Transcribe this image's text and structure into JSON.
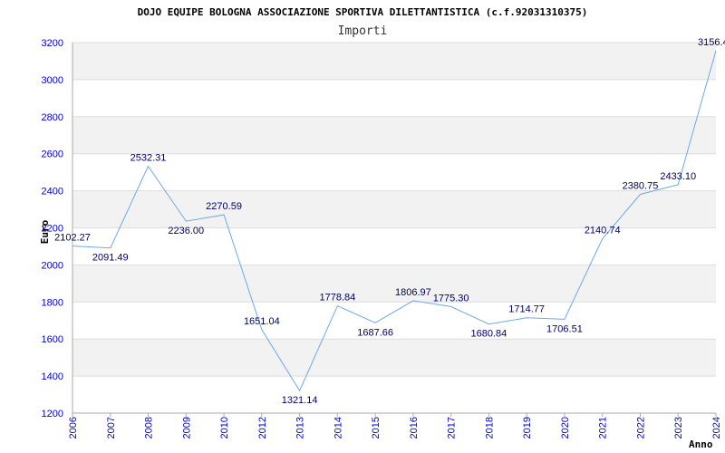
{
  "chart_data": {
    "type": "line",
    "title": "DOJO EQUIPE BOLOGNA ASSOCIAZIONE SPORTIVA DILETTANTISTICA (c.f.92031310375)",
    "subtitle": "Importi",
    "xlabel": "Anno",
    "ylabel": "Euro",
    "ylim": [
      1200,
      3200
    ],
    "yticks": [
      1200,
      1400,
      1600,
      1800,
      2000,
      2200,
      2400,
      2600,
      2800,
      3000,
      3200
    ],
    "x": [
      "2006",
      "2007",
      "2008",
      "2009",
      "2010",
      "2012",
      "2013",
      "2014",
      "2015",
      "2016",
      "2017",
      "2018",
      "2019",
      "2020",
      "2021",
      "2022",
      "2023",
      "2024"
    ],
    "values": [
      2102.27,
      2091.49,
      2532.31,
      2236.0,
      2270.59,
      1651.04,
      1321.14,
      1778.84,
      1687.66,
      1806.97,
      1775.3,
      1680.84,
      1714.77,
      1706.51,
      2140.74,
      2380.75,
      2433.1,
      3156.4
    ],
    "labels": [
      "2102.27",
      "2091.49",
      "2532.31",
      "2236.00",
      "2270.59",
      "1651.04",
      "1321.14",
      "1778.84",
      "1687.66",
      "1806.97",
      "1775.30",
      "1680.84",
      "1714.77",
      "1706.51",
      "2140.74",
      "2380.75",
      "2433.10",
      "3156.4"
    ],
    "grid": true,
    "line_color": "#6fa8e8",
    "tick_color": "#0000cc",
    "label_color": "#000066",
    "band_color": "#f2f2f2",
    "grid_color": "#dddddd"
  }
}
